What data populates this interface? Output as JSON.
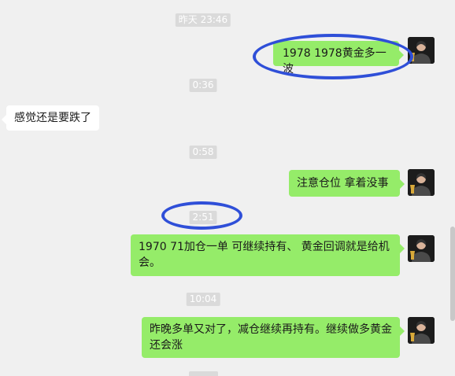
{
  "messages": [
    {
      "type": "time",
      "text": "昨天 23:46"
    },
    {
      "type": "msg",
      "side": "right",
      "text": "1978 1978黄金多一波"
    },
    {
      "type": "time",
      "text": "0:36"
    },
    {
      "type": "msg",
      "side": "left",
      "text": "感觉还是要跌了"
    },
    {
      "type": "time",
      "text": "0:58"
    },
    {
      "type": "msg",
      "side": "right",
      "text": "注意仓位  拿着没事"
    },
    {
      "type": "time",
      "text": "2:51"
    },
    {
      "type": "msg",
      "side": "right",
      "text": "1970 71加仓一单  可继续持有、  黄金回调就是给机会。"
    },
    {
      "type": "time",
      "text": "10:04"
    },
    {
      "type": "msg",
      "side": "right",
      "text": "昨晚多单又对了，减仓继续再持有。继续做多黄金还会涨"
    }
  ],
  "annotation_color": "#2f4fd8",
  "colors": {
    "background": "#f0f0f0",
    "bubble_right": "#95ec69",
    "bubble_left": "#ffffff",
    "time_badge": "#dadada"
  }
}
